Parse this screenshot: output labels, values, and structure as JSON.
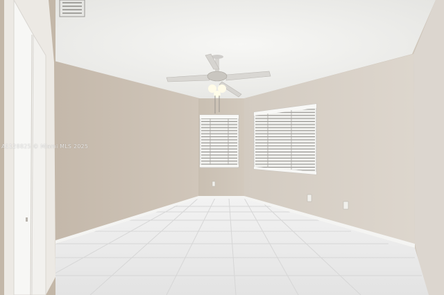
{
  "watermark": "A1128825 © Miami MLS 2025",
  "colors": {
    "wall_left": "#c9beb1",
    "wall_back": "#cdc3b6",
    "wall_right": "#d4ccc2",
    "ceiling": "#f1f1ef",
    "floor": "#eaeaea",
    "baseboard": "#f4f4f2",
    "door": "#f7f7f5"
  },
  "objects": {
    "ceiling_fan": "ceiling-fan",
    "window_blinds": [
      "window-blinds-small",
      "window-blinds-large"
    ],
    "closet_door": "bifold-closet-door",
    "air_vent": "ceiling-air-vent"
  }
}
